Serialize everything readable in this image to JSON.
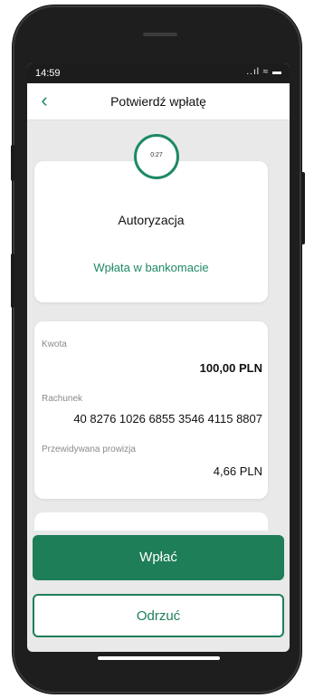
{
  "status": {
    "time": "14:59",
    "icons": "..ıl ≈ ▬"
  },
  "header": {
    "back_icon": "‹",
    "title": "Potwierdź wpłatę"
  },
  "timer": {
    "text": "0:27"
  },
  "authorization": {
    "title": "Autoryzacja",
    "subtitle": "Wpłata w bankomacie"
  },
  "details": {
    "amount_label": "Kwota",
    "amount_value": "100,00 PLN",
    "account_label": "Rachunek",
    "account_value": "40 8276 1026 6855 3546 4115 8807",
    "fee_label": "Przewidywana prowizja",
    "fee_value": "4,66 PLN"
  },
  "actions": {
    "primary_label": "Wpłać",
    "secondary_label": "Odrzuć"
  },
  "colors": {
    "accent": "#1e8a64",
    "button": "#1e7e58",
    "background": "#e9e9e9"
  }
}
